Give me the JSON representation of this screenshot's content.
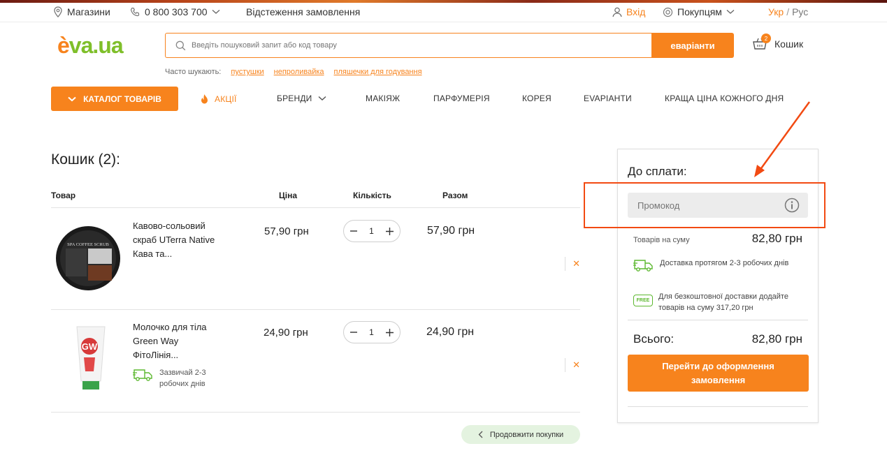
{
  "topbar": {
    "stores": "Магазини",
    "phone": "0 800 303 700",
    "tracking": "Відстеження замовлення",
    "login": "Вхід",
    "customers": "Покупцям",
    "lang_ukr": "Укр",
    "lang_sep": "/",
    "lang_rus": "Рус"
  },
  "header": {
    "logo_e": "è",
    "logo_rest": "va.ua",
    "search_placeholder": "Введіть пошуковий запит або код товару",
    "search_button": "еваріанти",
    "cart_label": "Кошик",
    "cart_count": "2"
  },
  "often": {
    "label": "Часто шукають:",
    "links": [
      "пустушки",
      "непроливайка",
      "пляшечки для годування"
    ]
  },
  "nav": {
    "catalog": "КАТАЛОГ ТОВАРІВ",
    "items": [
      "АКЦІЇ",
      "БРЕНДИ",
      "МАКІЯЖ",
      "ПАРФУМЕРІЯ",
      "КОРЕЯ",
      "EVAРІАНТИ",
      "КРАЩА ЦІНА КОЖНОГО ДНЯ"
    ]
  },
  "cart": {
    "title": "Кошик (2):",
    "columns": {
      "product": "Товар",
      "price": "Ціна",
      "quantity": "Кількість",
      "total": "Разом"
    },
    "items": [
      {
        "name": "Кавово-сольовий скраб UTerra Native Кава та...",
        "price": "57,90 грн",
        "quantity": "1",
        "total": "57,90 грн",
        "image_text": "SPA COFFEE SCRUB"
      },
      {
        "name": "Молочко для тіла Green Way ФітоЛінія...",
        "price": "24,90 грн",
        "quantity": "1",
        "total": "24,90 грн",
        "image_text": "GW",
        "delivery_note": "Зазвичай 2-3 робочих днів"
      }
    ],
    "remove_symbol": "✕",
    "continue": "Продовжити покупки"
  },
  "summary": {
    "title": "До сплати:",
    "promo_placeholder": "Промокод",
    "goods_sum_label": "Товарів на суму",
    "goods_sum_value": "82,80 грн",
    "delivery_info": "Доставка протягом 2-3 робочих днів",
    "free_badge": "FREE",
    "free_info": "Для безкоштовної доставки додайте товарів на суму 317,20 грн",
    "total_label": "Всього:",
    "total_value": "82,80 грн",
    "checkout": "Перейти до оформлення замовлення"
  },
  "colors": {
    "accent": "#f7831d",
    "logo_green": "#7fbf2a",
    "annotation": "#f24a12",
    "delivery_green": "#5cb82f"
  }
}
